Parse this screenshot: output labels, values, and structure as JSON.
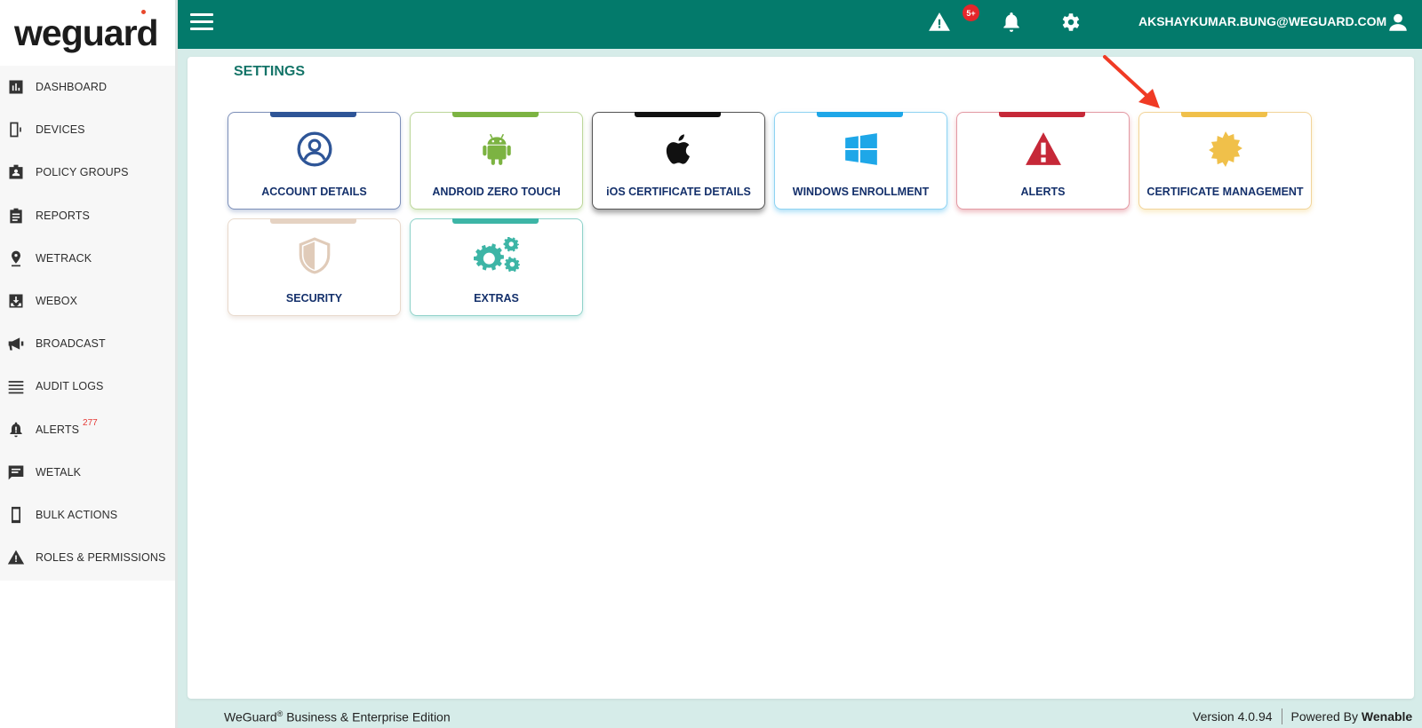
{
  "brand": {
    "logo_text": "weguard"
  },
  "sidebar": {
    "items": [
      {
        "label": "DASHBOARD",
        "icon": "bar-chart-icon"
      },
      {
        "label": "DEVICES",
        "icon": "device-icon"
      },
      {
        "label": "POLICY GROUPS",
        "icon": "policy-badge-icon"
      },
      {
        "label": "REPORTS",
        "icon": "clipboard-icon"
      },
      {
        "label": "WETRACK",
        "icon": "location-pin-icon"
      },
      {
        "label": "WEBOX",
        "icon": "inbox-download-icon"
      },
      {
        "label": "BROADCAST",
        "icon": "megaphone-icon"
      },
      {
        "label": "AUDIT LOGS",
        "icon": "list-lines-icon"
      },
      {
        "label": "ALERTS",
        "icon": "bell-alert-icon",
        "badge": "277"
      },
      {
        "label": "WETALK",
        "icon": "chat-icon"
      },
      {
        "label": "BULK ACTIONS",
        "icon": "phone-icon"
      },
      {
        "label": "ROLES & PERMISSIONS",
        "icon": "warning-triangle-icon"
      }
    ]
  },
  "header": {
    "alert_badge": "5+",
    "user_email": "AKSHAYKUMAR.BUNG@WEGUARD.COM"
  },
  "page": {
    "title": "SETTINGS"
  },
  "cards": [
    {
      "label": "ACCOUNT DETAILS",
      "icon": "user-circle-icon",
      "accent": "#2e5597"
    },
    {
      "label": "ANDROID ZERO TOUCH",
      "icon": "android-icon",
      "accent": "#7cb342"
    },
    {
      "label": "iOS CERTIFICATE DETAILS",
      "icon": "apple-icon",
      "accent": "#111111"
    },
    {
      "label": "WINDOWS ENROLLMENT",
      "icon": "windows-icon",
      "accent": "#1ea7e8"
    },
    {
      "label": "ALERTS",
      "icon": "warning-icon",
      "accent": "#c62838"
    },
    {
      "label": "CERTIFICATE MANAGEMENT",
      "icon": "certificate-seal-icon",
      "accent": "#f0c04a"
    },
    {
      "label": "SECURITY",
      "icon": "shield-icon",
      "accent": "#e5d2c2"
    },
    {
      "label": "EXTRAS",
      "icon": "gears-icon",
      "accent": "#3db5a6"
    }
  ],
  "footer": {
    "brand": "WeGuard",
    "edition": " Business & Enterprise Edition",
    "version": "Version 4.0.94",
    "powered_prefix": "Powered By ",
    "powered_brand": "Wenable"
  },
  "colors": {
    "header_bg": "#037a6b",
    "title_teal": "#147468",
    "card_label": "#14306b",
    "arrow": "#f03a24"
  }
}
